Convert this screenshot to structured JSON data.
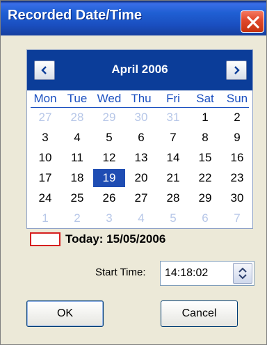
{
  "window": {
    "title": "Recorded Date/Time"
  },
  "calendar": {
    "month_label": "April 2006",
    "weekdays": [
      "Mon",
      "Tue",
      "Wed",
      "Thu",
      "Fri",
      "Sat",
      "Sun"
    ],
    "weeks": [
      [
        {
          "d": "27",
          "other": true
        },
        {
          "d": "28",
          "other": true
        },
        {
          "d": "29",
          "other": true
        },
        {
          "d": "30",
          "other": true
        },
        {
          "d": "31",
          "other": true
        },
        {
          "d": "1"
        },
        {
          "d": "2"
        }
      ],
      [
        {
          "d": "3"
        },
        {
          "d": "4"
        },
        {
          "d": "5"
        },
        {
          "d": "6"
        },
        {
          "d": "7"
        },
        {
          "d": "8"
        },
        {
          "d": "9"
        }
      ],
      [
        {
          "d": "10"
        },
        {
          "d": "11"
        },
        {
          "d": "12"
        },
        {
          "d": "13"
        },
        {
          "d": "14"
        },
        {
          "d": "15"
        },
        {
          "d": "16"
        }
      ],
      [
        {
          "d": "17"
        },
        {
          "d": "18"
        },
        {
          "d": "19",
          "selected": true
        },
        {
          "d": "20"
        },
        {
          "d": "21"
        },
        {
          "d": "22"
        },
        {
          "d": "23"
        }
      ],
      [
        {
          "d": "24"
        },
        {
          "d": "25"
        },
        {
          "d": "26"
        },
        {
          "d": "27"
        },
        {
          "d": "28"
        },
        {
          "d": "29"
        },
        {
          "d": "30"
        }
      ],
      [
        {
          "d": "1",
          "other": true
        },
        {
          "d": "2",
          "other": true
        },
        {
          "d": "3",
          "other": true
        },
        {
          "d": "4",
          "other": true
        },
        {
          "d": "5",
          "other": true
        },
        {
          "d": "6",
          "other": true
        },
        {
          "d": "7",
          "other": true
        }
      ]
    ],
    "today_label": "Today: 15/05/2006"
  },
  "start_time": {
    "label": "Start Time:",
    "value": "14:18:02"
  },
  "buttons": {
    "ok": "OK",
    "cancel": "Cancel"
  },
  "colors": {
    "accent": "#1a4fc0",
    "header": "#0b3d99",
    "selected": "#1f4db3",
    "today_border": "#d61f1f"
  }
}
